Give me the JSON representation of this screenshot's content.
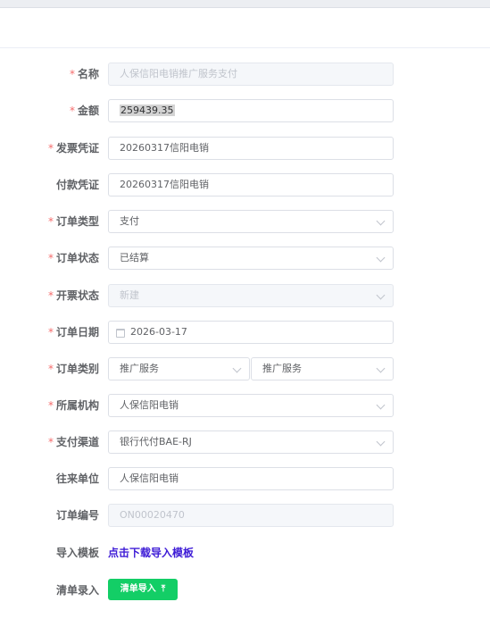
{
  "form": {
    "name": {
      "label": "名称",
      "value": "人保信阳电销推广服务支付"
    },
    "amount": {
      "label": "金额",
      "value": "259439.35"
    },
    "invoice": {
      "label": "发票凭证",
      "value": "20260317信阳电销"
    },
    "payment": {
      "label": "付款凭证",
      "value": "20260317信阳电销"
    },
    "order_type": {
      "label": "订单类型",
      "value": "支付"
    },
    "order_status": {
      "label": "订单状态",
      "value": "已结算"
    },
    "invoice_status": {
      "label": "开票状态",
      "value": "新建"
    },
    "order_date": {
      "label": "订单日期",
      "value": "2026-03-17"
    },
    "order_category": {
      "label": "订单类别",
      "value1": "推广服务",
      "value2": "推广服务"
    },
    "org": {
      "label": "所属机构",
      "value": "人保信阳电销"
    },
    "channel": {
      "label": "支付渠道",
      "value": "银行代付BAE-RJ"
    },
    "partner": {
      "label": "往来单位",
      "value": "人保信阳电销"
    },
    "order_no": {
      "label": "订单编号",
      "value": "ON00020470"
    },
    "template": {
      "label": "导入模板",
      "link": "点击下载导入模板"
    },
    "list_entry": {
      "label": "清单录入",
      "button": "清单导入",
      "icon": "upload-icon"
    }
  },
  "colors": {
    "required": "#f56c6c",
    "link": "#3d1bd6",
    "button": "#13ce66"
  }
}
